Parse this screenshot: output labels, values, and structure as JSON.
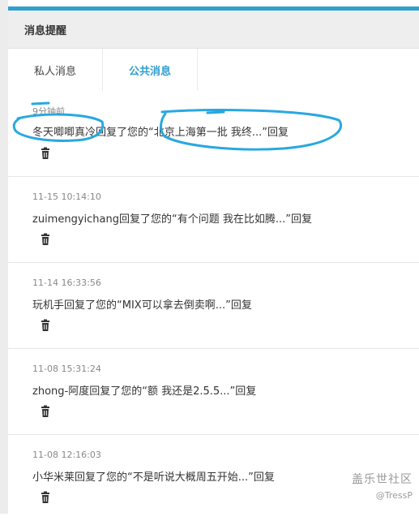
{
  "header": {
    "title": "消息提醒"
  },
  "tabs": [
    {
      "label": "私人消息"
    },
    {
      "label": "公共消息"
    }
  ],
  "messages": [
    {
      "time": "9分钟前",
      "text": "冬天唧唧真冷回复了您的“北京上海第一批 我终...”回复"
    },
    {
      "time": "11-15 10:14:10",
      "text": "zuimengyichang回复了您的“有个问题 我在比如腾...”回复"
    },
    {
      "time": "11-14 16:33:56",
      "text": "玩机手回复了您的“MIX可以拿去倒卖啊...”回复"
    },
    {
      "time": "11-08 15:31:24",
      "text": "zhong-阿度回复了您的“额 我还是2.5.5...”回复"
    },
    {
      "time": "11-08 12:16:03",
      "text": "小华米莱回复了您的“不是听说大概周五开始...”回复"
    }
  ],
  "icons": {
    "delete": "trash-icon"
  },
  "colors": {
    "accent": "#2f9fd0",
    "annotation": "#29a8e0"
  },
  "watermark": {
    "site": "盖乐世社区",
    "user": "@TressP"
  }
}
